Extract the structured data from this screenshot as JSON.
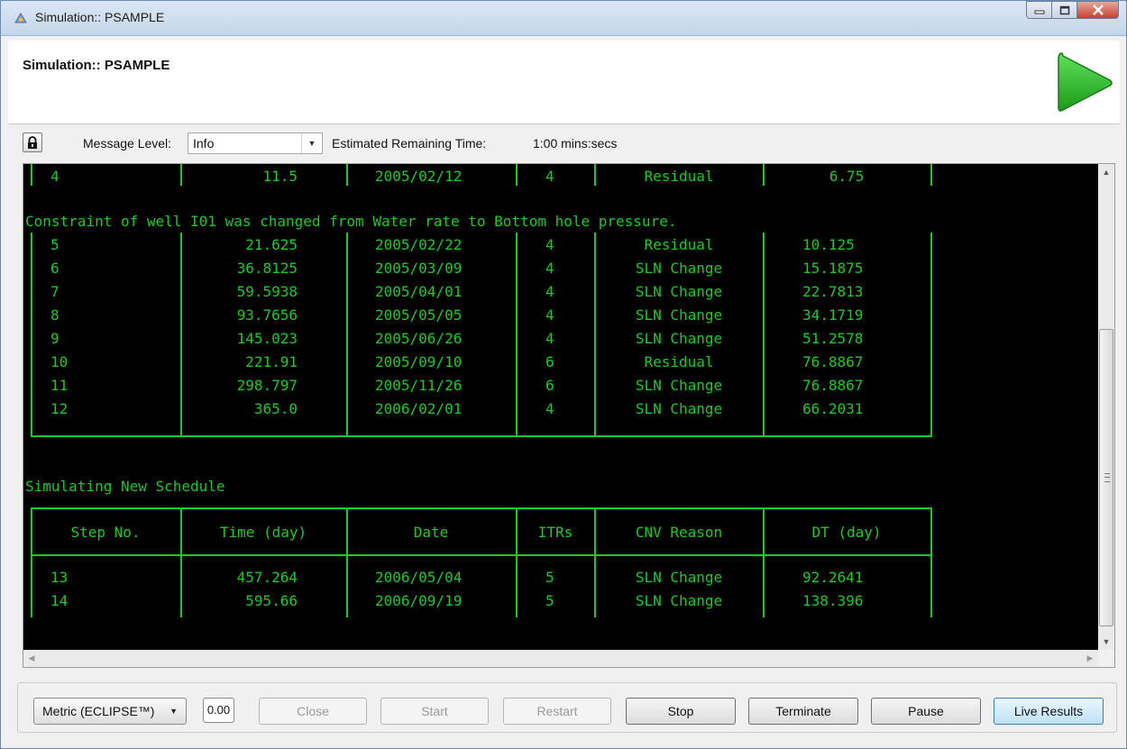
{
  "window": {
    "title": "Simulation:: PSAMPLE"
  },
  "header": {
    "title": "Simulation:: PSAMPLE"
  },
  "toolbar": {
    "message_level_label": "Message Level:",
    "message_level_value": "Info",
    "remaining_label": "Estimated Remaining Time:",
    "remaining_value": "1:00 mins:secs"
  },
  "console": {
    "top_row": {
      "step": "4",
      "time": "11.5",
      "date": "2005/02/12",
      "itrs": "4",
      "reason": "Residual",
      "dt": "6.75"
    },
    "constraint_message": "Constraint of well I01 was changed from Water rate to Bottom hole pressure.",
    "rows": [
      {
        "step": "5",
        "time": "21.625",
        "date": "2005/02/22",
        "itrs": "4",
        "reason": "Residual",
        "dt": "10.125"
      },
      {
        "step": "6",
        "time": "36.8125",
        "date": "2005/03/09",
        "itrs": "4",
        "reason": "SLN Change",
        "dt": "15.1875"
      },
      {
        "step": "7",
        "time": "59.5938",
        "date": "2005/04/01",
        "itrs": "4",
        "reason": "SLN Change",
        "dt": "22.7813"
      },
      {
        "step": "8",
        "time": "93.7656",
        "date": "2005/05/05",
        "itrs": "4",
        "reason": "SLN Change",
        "dt": "34.1719"
      },
      {
        "step": "9",
        "time": "145.023",
        "date": "2005/06/26",
        "itrs": "4",
        "reason": "SLN Change",
        "dt": "51.2578"
      },
      {
        "step": "10",
        "time": "221.91",
        "date": "2005/09/10",
        "itrs": "6",
        "reason": "Residual",
        "dt": "76.8867"
      },
      {
        "step": "11",
        "time": "298.797",
        "date": "2005/11/26",
        "itrs": "6",
        "reason": "SLN Change",
        "dt": "76.8867"
      },
      {
        "step": "12",
        "time": "365.0",
        "date": "2006/02/01",
        "itrs": "4",
        "reason": "SLN Change",
        "dt": "66.2031"
      }
    ],
    "new_schedule_message": "Simulating New Schedule",
    "headers": {
      "step": "Step No.",
      "time": "Time (day)",
      "date": "Date",
      "itrs": "ITRs",
      "reason": "CNV Reason",
      "dt": "DT (day)"
    },
    "rows2": [
      {
        "step": "13",
        "time": "457.264",
        "date": "2006/05/04",
        "itrs": "5",
        "reason": "SLN Change",
        "dt": "92.2641"
      },
      {
        "step": "14",
        "time": "595.66",
        "date": "2006/09/19",
        "itrs": "5",
        "reason": "SLN Change",
        "dt": "138.396"
      }
    ]
  },
  "bottom": {
    "unit_system": "Metric (ECLIPSE™)",
    "value": "0.00",
    "buttons": {
      "close": "Close",
      "start": "Start",
      "restart": "Restart",
      "stop": "Stop",
      "terminate": "Terminate",
      "pause": "Pause",
      "live_results": "Live Results"
    }
  },
  "colors": {
    "console_bg": "#000000",
    "console_text": "#17cc23",
    "play_green": "#2fb82a",
    "title_bar": "#c4d6ea"
  },
  "icons": [
    "app-icon",
    "minimize-icon",
    "maximize-icon",
    "close-icon",
    "play-icon",
    "lock-icon",
    "chevron-down-icon",
    "scroll-up-icon",
    "scroll-down-icon",
    "scroll-left-icon",
    "scroll-right-icon"
  ]
}
